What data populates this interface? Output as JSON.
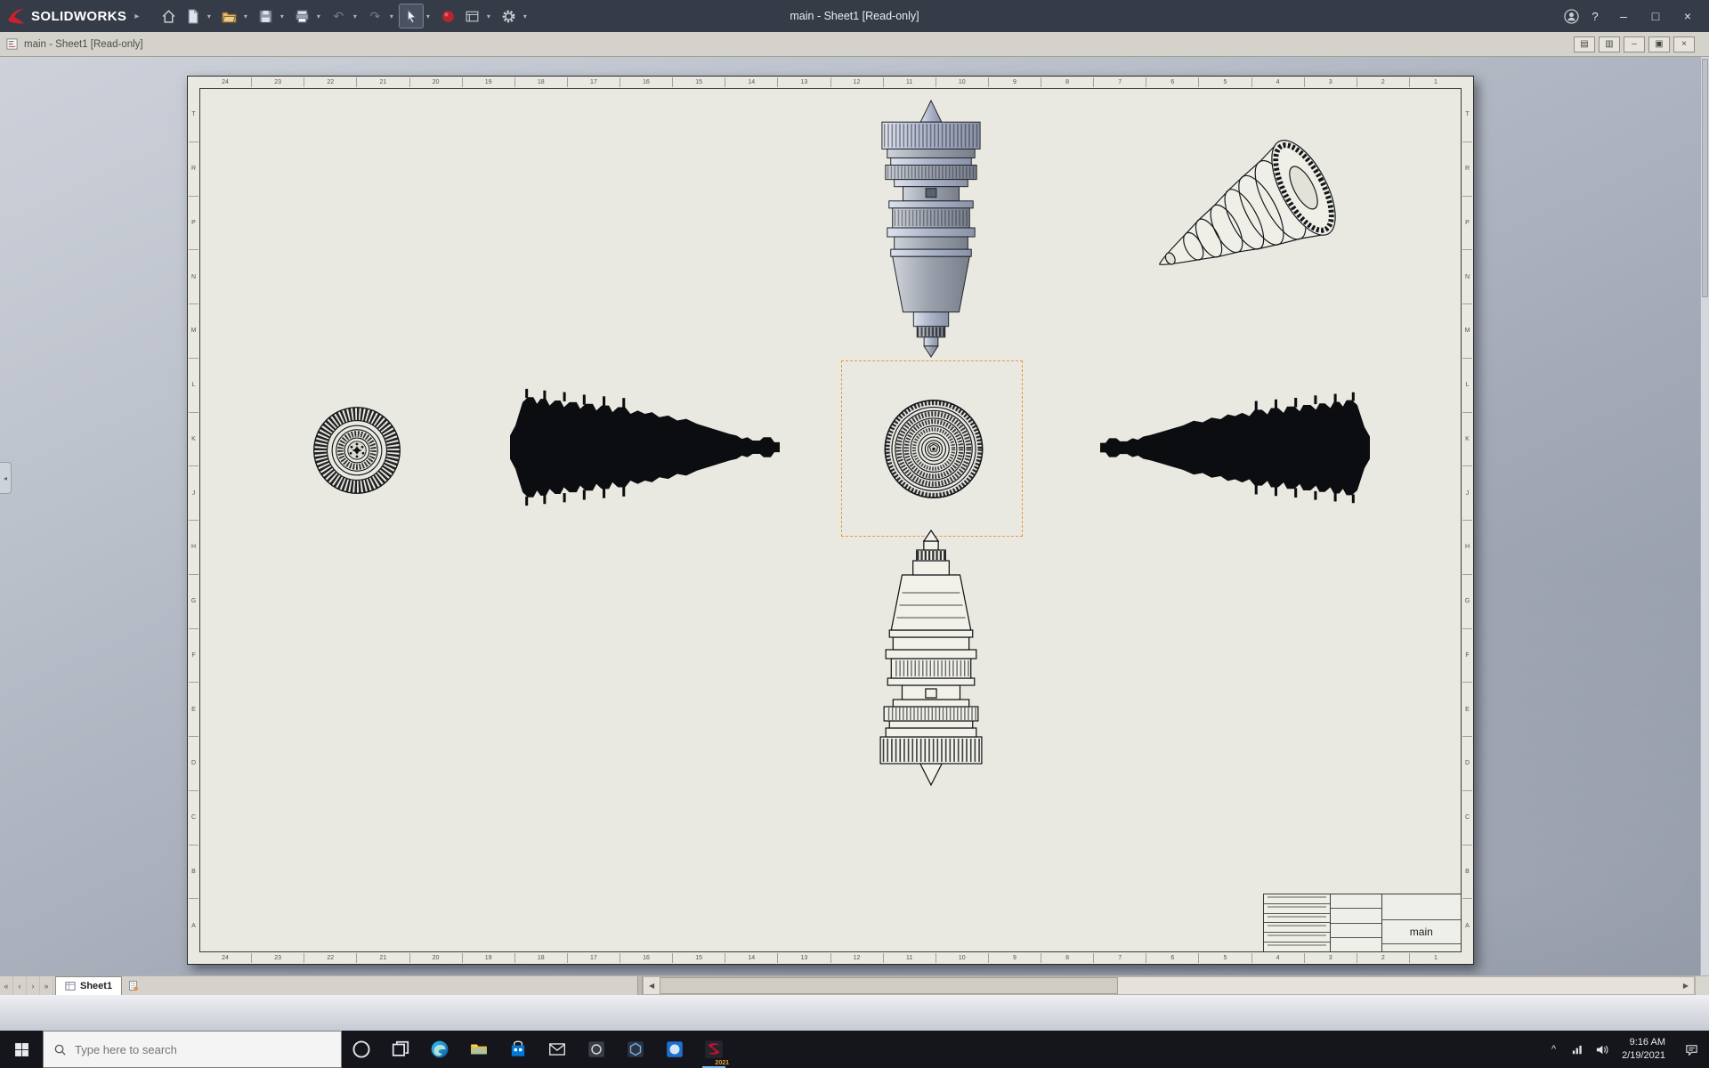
{
  "colors": {
    "titlebar_bg": "#363c47",
    "docbar_bg": "#d5d2cb",
    "sheet_bg": "#e9e9e1",
    "taskbar_bg": "#15161c",
    "accent_selection": "#e8973c",
    "brand_red": "#cf1f2f"
  },
  "titlebar": {
    "brand": "SOLIDWORKS",
    "title": "main - Sheet1 [Read-only]"
  },
  "doc_window": {
    "title": "main - Sheet1 [Read-only]"
  },
  "glyphs": {
    "menu_expand": "▸",
    "dropdown": "▾",
    "undo": "↶",
    "redo": "↷",
    "help": "?",
    "minimize": "–",
    "maximize": "□",
    "close": "×",
    "doc_window_1": "▤",
    "doc_window_2": "▥",
    "doc_minimize": "–",
    "doc_restore": "▣",
    "doc_close": "×",
    "nav_first": "«",
    "nav_prev": "‹",
    "nav_next": "›",
    "nav_last": "»",
    "scroll_left": "◀",
    "scroll_right": "▶",
    "collapse_left": "◂",
    "tray_expand": "^"
  },
  "sheet": {
    "zone_columns": [
      "24",
      "23",
      "22",
      "21",
      "20",
      "19",
      "18",
      "17",
      "16",
      "15",
      "14",
      "13",
      "12",
      "11",
      "10",
      "9",
      "8",
      "7",
      "6",
      "5",
      "4",
      "3",
      "2",
      "1"
    ],
    "zone_rows": [
      "T",
      "R",
      "P",
      "N",
      "M",
      "L",
      "K",
      "J",
      "H",
      "G",
      "F",
      "E",
      "D",
      "C",
      "B",
      "A"
    ],
    "title_block": {
      "drawing_name": "main"
    }
  },
  "tabs": {
    "sheet": "Sheet1"
  },
  "taskbar": {
    "search_placeholder": "Type here to search",
    "solidworks_year": "2021",
    "clock": {
      "time": "9:16 AM",
      "date": "2/19/2021"
    }
  }
}
